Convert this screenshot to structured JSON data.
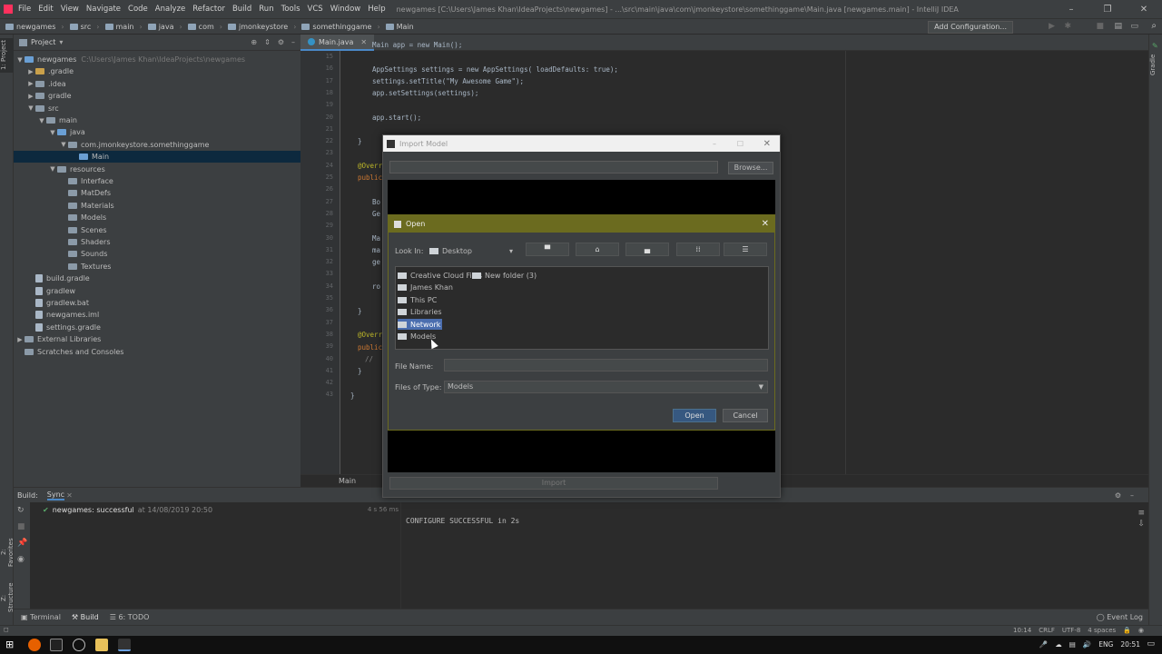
{
  "window": {
    "menu": [
      "File",
      "Edit",
      "View",
      "Navigate",
      "Code",
      "Analyze",
      "Refactor",
      "Build",
      "Run",
      "Tools",
      "VCS",
      "Window",
      "Help"
    ],
    "title": "newgames [C:\\Users\\James Khan\\IdeaProjects\\newgames] - ...\\src\\main\\java\\com\\jmonkeystore\\somethinggame\\Main.java [newgames.main] - IntelliJ IDEA"
  },
  "breadcrumbs": [
    "newgames",
    "src",
    "main",
    "java",
    "com",
    "jmonkeystore",
    "somethinggame",
    "Main"
  ],
  "toolbar": {
    "add_config": "Add Configuration..."
  },
  "side_tabs": {
    "project": "1: Project",
    "favorites": "2: Favorites",
    "structure": "Z: Structure",
    "gradle": "Gradle"
  },
  "project": {
    "header": "Project",
    "tree": [
      {
        "label": "newgames",
        "hint": "C:\\Users\\James Khan\\IdeaProjects\\newgames",
        "depth": 0,
        "arrow": "▼",
        "kind": "b"
      },
      {
        "label": ".gradle",
        "depth": 1,
        "arrow": "▶",
        "kind": "o"
      },
      {
        "label": ".idea",
        "depth": 1,
        "arrow": "▶",
        "kind": "n"
      },
      {
        "label": "gradle",
        "depth": 1,
        "arrow": "▶",
        "kind": "n"
      },
      {
        "label": "src",
        "depth": 1,
        "arrow": "▼",
        "kind": "n"
      },
      {
        "label": "main",
        "depth": 2,
        "arrow": "▼",
        "kind": "n"
      },
      {
        "label": "java",
        "depth": 3,
        "arrow": "▼",
        "kind": "b"
      },
      {
        "label": "com.jmonkeystore.somethinggame",
        "depth": 4,
        "arrow": "▼",
        "kind": "n"
      },
      {
        "label": "Main",
        "depth": 5,
        "arrow": "",
        "kind": "b",
        "selected": true
      },
      {
        "label": "resources",
        "depth": 3,
        "arrow": "▼",
        "kind": "n"
      },
      {
        "label": "Interface",
        "depth": 4,
        "arrow": "",
        "kind": "n"
      },
      {
        "label": "MatDefs",
        "depth": 4,
        "arrow": "",
        "kind": "n"
      },
      {
        "label": "Materials",
        "depth": 4,
        "arrow": "",
        "kind": "n"
      },
      {
        "label": "Models",
        "depth": 4,
        "arrow": "",
        "kind": "n"
      },
      {
        "label": "Scenes",
        "depth": 4,
        "arrow": "",
        "kind": "n"
      },
      {
        "label": "Shaders",
        "depth": 4,
        "arrow": "",
        "kind": "n"
      },
      {
        "label": "Sounds",
        "depth": 4,
        "arrow": "",
        "kind": "n"
      },
      {
        "label": "Textures",
        "depth": 4,
        "arrow": "",
        "kind": "n"
      },
      {
        "label": "build.gradle",
        "depth": 1,
        "arrow": "",
        "kind": "f"
      },
      {
        "label": "gradlew",
        "depth": 1,
        "arrow": "",
        "kind": "f"
      },
      {
        "label": "gradlew.bat",
        "depth": 1,
        "arrow": "",
        "kind": "f"
      },
      {
        "label": "newgames.iml",
        "depth": 1,
        "arrow": "",
        "kind": "f"
      },
      {
        "label": "settings.gradle",
        "depth": 1,
        "arrow": "",
        "kind": "f"
      },
      {
        "label": "External Libraries",
        "depth": 0,
        "arrow": "▶",
        "kind": "n"
      },
      {
        "label": "Scratches and Consoles",
        "depth": 0,
        "arrow": "",
        "kind": "n"
      }
    ]
  },
  "editor": {
    "tab": "Main.java",
    "footer": "Main",
    "lines": [
      "15",
      "16",
      "17",
      "18",
      "19",
      "20",
      "21",
      "22",
      "23",
      "24",
      "25",
      "26",
      "27",
      "28",
      "29",
      "30",
      "31",
      "32",
      "33",
      "34",
      "35",
      "36",
      "37",
      "38",
      "39",
      "40",
      "41",
      "42",
      "43"
    ],
    "code": [
      {
        "text": "Main app = new Main();"
      },
      {
        "text": ""
      },
      {
        "text": "AppSettings settings = new AppSettings( loadDefaults: true);"
      },
      {
        "text": "settings.setTitle(\"My Awesome Game\");"
      },
      {
        "text": "app.setSettings(settings);"
      },
      {
        "text": ""
      },
      {
        "text": "app.start();"
      },
      {
        "text": ""
      },
      {
        "text": "}"
      },
      {
        "text": ""
      },
      {
        "text": "@Overr"
      },
      {
        "text": "public"
      },
      {
        "text": ""
      },
      {
        "text": "Bo"
      },
      {
        "text": "Ge"
      },
      {
        "text": ""
      },
      {
        "text": "Ma"
      },
      {
        "text": "ma"
      },
      {
        "text": "ge"
      },
      {
        "text": ""
      },
      {
        "text": "ro"
      },
      {
        "text": ""
      },
      {
        "text": "}"
      },
      {
        "text": ""
      },
      {
        "text": "@Overr"
      },
      {
        "text": "public"
      },
      {
        "text": "//"
      },
      {
        "text": "}"
      },
      {
        "text": ""
      },
      {
        "text": "}"
      }
    ]
  },
  "build": {
    "tabs": [
      "Build:",
      "Sync"
    ],
    "result": "newgames: successful",
    "result_time": "at 14/08/2019 20:50",
    "duration": "4 s 56 ms",
    "console": "CONFIGURE SUCCESSFUL in 2s"
  },
  "bottom_tabs": [
    "Terminal",
    "Build",
    "6: TODO"
  ],
  "event_log": "Event Log",
  "status": {
    "pos": "10:14",
    "eol": "CRLF",
    "enc": "UTF-8",
    "indent": "4 spaces"
  },
  "taskbar": {
    "lang": "ENG",
    "time": "20:51"
  },
  "import_dialog": {
    "title": "Import Model",
    "browse": "Browse...",
    "import": "Import"
  },
  "open_dialog": {
    "title": "Open",
    "look_in_label": "Look In:",
    "look_in_value": "Desktop",
    "items": [
      {
        "label": "Creative Cloud Files"
      },
      {
        "label": "New folder (3)"
      },
      {
        "label": "James Khan"
      },
      {
        "label": "This PC"
      },
      {
        "label": "Libraries"
      },
      {
        "label": "Network",
        "selected": true
      },
      {
        "label": "Models"
      }
    ],
    "file_name_label": "File Name:",
    "file_name_value": "",
    "files_of_type_label": "Files of Type:",
    "files_of_type_value": "Models",
    "open": "Open",
    "cancel": "Cancel"
  }
}
